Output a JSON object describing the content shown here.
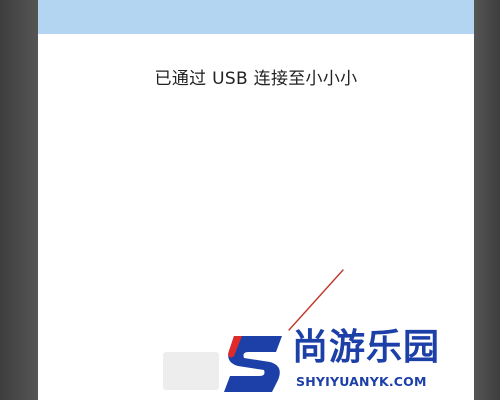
{
  "dialog": {
    "message": "已通过 USB 连接至小小小"
  },
  "watermark": {
    "title": "尚游乐园",
    "url": "SHYIYUANYK.COM"
  },
  "colors": {
    "header_bar": "#b3d5f1",
    "panel": "#ffffff",
    "frame": "#4d4d4d",
    "annotation_line": "#c0392b",
    "watermark_blue": "#1c3fa8",
    "watermark_red": "#e02a2a"
  }
}
